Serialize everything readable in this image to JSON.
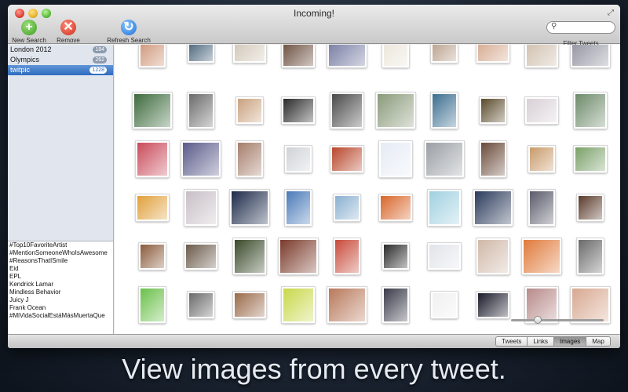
{
  "window": {
    "title": "Incoming!"
  },
  "toolbar": {
    "new_search": "New Search",
    "remove_search": "Remove Search",
    "refresh_search": "Refresh Search",
    "filter_label": "Filter Tweets",
    "filter_value": "",
    "filter_placeholder": ""
  },
  "sidebar": {
    "searches": [
      {
        "label": "London 2012",
        "count": "184",
        "selected": false
      },
      {
        "label": "Olympics",
        "count": "262",
        "selected": false
      },
      {
        "label": "twitpic",
        "count": "1228",
        "selected": true
      }
    ],
    "trends": [
      "#Top10FavoriteArtist",
      "#MentionSomeoneWhoIsAwesome",
      "#ReasonsThatISmile",
      "Eid",
      "EPL",
      "Kendrick Lamar",
      "Mindless Behavior",
      "Juicy J",
      "Frank Ocean",
      "#MiVidaSocialEstáMásMuertaQue"
    ]
  },
  "view_tabs": [
    "Tweets",
    "Links",
    "Images",
    "Map"
  ],
  "active_tab": "Images",
  "zoom": {
    "level": 0.27
  },
  "thumbnails": [
    [
      "#c98a6a",
      "#3d5a72",
      "#cfc4b4",
      "#5a3a28",
      "#6a6f9a",
      "#e9e3d6",
      "#b59a85",
      "#d4a58a",
      "#cbb9a5",
      "#8a8a99"
    ],
    [
      "#3e6b3e",
      "#6b6b6b",
      "#caa27f",
      "#2a2a2a",
      "#4a4a4a",
      "#8a9a7a",
      "#3b6e8f",
      "#5a4a2a",
      "#d8d0d6",
      "#6d8a6a"
    ],
    [
      "#c94a5a",
      "#5a5a8a",
      "#a57d6a",
      "#cfd2d6",
      "#b8462a",
      "#e6ecf5",
      "#9a9fa5",
      "#6a4a3a",
      "#c89a6a",
      "#7aa068"
    ],
    [
      "#e0a03a",
      "#c8bfc6",
      "#1d2a4a",
      "#4a7ab8",
      "#8ab0d0",
      "#d8662a",
      "#a0d0e0",
      "#2a3a5a",
      "#5a5a6a",
      "#5a3a2a"
    ],
    [
      "#8a5a3a",
      "#6a5a4a",
      "#3a4a2a",
      "#7a3a2a",
      "#c84a3a",
      "#2a2a2a",
      "#e2e4ea",
      "#d0b8a8",
      "#e07a3a",
      "#6a6a6a"
    ],
    [
      "#6ac04a",
      "#6a6a6a",
      "#9a6a4a",
      "#c9d84a",
      "#b8785a",
      "#3a3a4a",
      "#f0f0f0",
      "#1a1a2a",
      "#b88a8a",
      "#d8a890"
    ]
  ],
  "caption": "View images from every tweet."
}
